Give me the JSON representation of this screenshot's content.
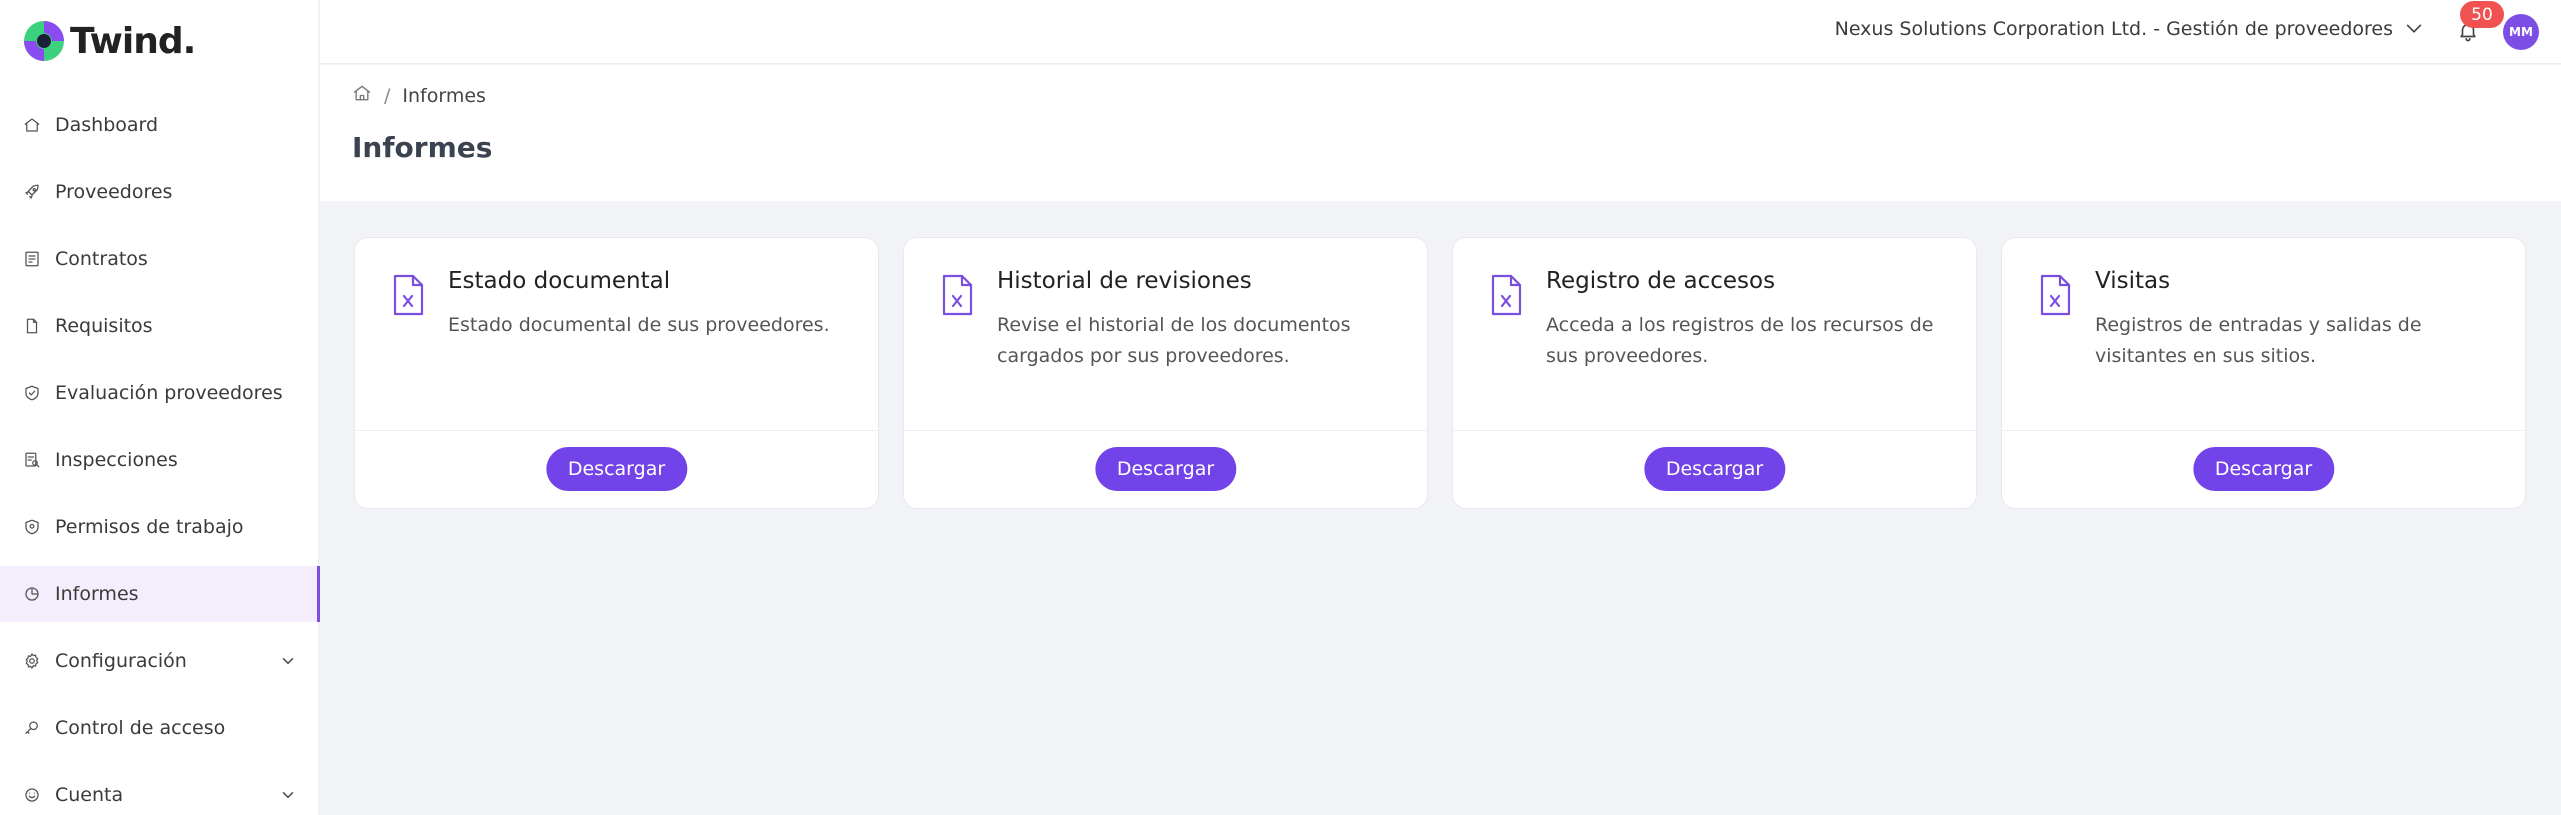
{
  "brand": {
    "name": "Twind.",
    "colors": {
      "accent": "#7243e8",
      "logo_green": "#3bd17f",
      "logo_purple": "#8a4cf0",
      "badge": "#f05252"
    }
  },
  "sidebar": {
    "items": [
      {
        "label": "Dashboard",
        "icon": "home-icon"
      },
      {
        "label": "Proveedores",
        "icon": "rocket-icon"
      },
      {
        "label": "Contratos",
        "icon": "contract-icon"
      },
      {
        "label": "Requisitos",
        "icon": "file-icon"
      },
      {
        "label": "Evaluación proveedores",
        "icon": "shield-check-icon"
      },
      {
        "label": "Inspecciones",
        "icon": "inspection-icon"
      },
      {
        "label": "Permisos de trabajo",
        "icon": "shield-icon"
      },
      {
        "label": "Informes",
        "icon": "pie-chart-icon",
        "active": true
      },
      {
        "label": "Configuración",
        "icon": "gear-icon",
        "expandable": true
      },
      {
        "label": "Control de acceso",
        "icon": "key-icon"
      },
      {
        "label": "Cuenta",
        "icon": "smile-icon",
        "expandable": true
      }
    ]
  },
  "topbar": {
    "org_name": "Nexus Solutions Corporation Ltd. - Gestión de proveedores",
    "notifications_count": "50",
    "avatar_initials": "MM"
  },
  "breadcrumb": {
    "current": "Informes",
    "separator": "/"
  },
  "page_title": "Informes",
  "cards": [
    {
      "title": "Estado documental",
      "description": "Estado documental de sus proveedores.",
      "button": "Descargar"
    },
    {
      "title": "Historial de revisiones",
      "description": "Revise el historial de los documentos cargados por sus proveedores.",
      "button": "Descargar"
    },
    {
      "title": "Registro de accesos",
      "description": "Acceda a los registros de los recursos de sus proveedores.",
      "button": "Descargar"
    },
    {
      "title": "Visitas",
      "description": "Registros de entradas y salidas de visitantes en sus sitios.",
      "button": "Descargar"
    }
  ]
}
